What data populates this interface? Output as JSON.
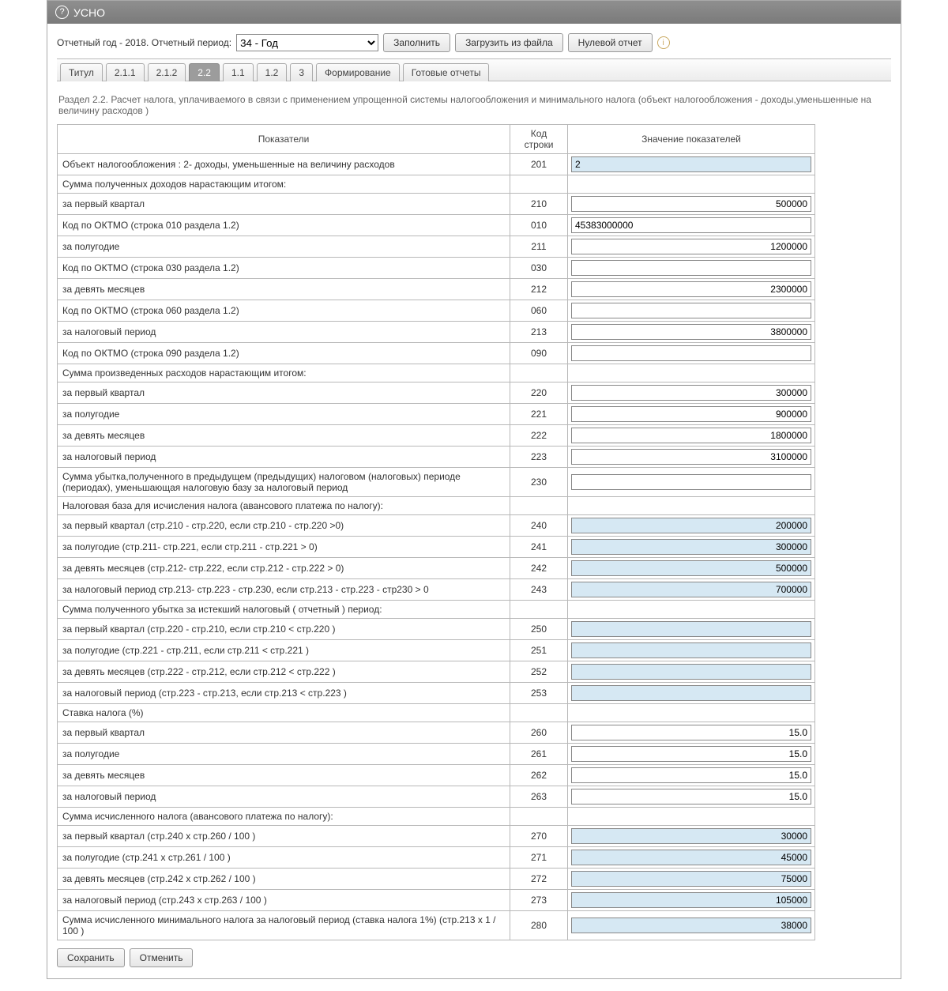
{
  "titlebar": {
    "title": "УСНО",
    "help_icon": "?"
  },
  "filters": {
    "year_label": "Отчетный год - 2018.  Отчетный период:",
    "period_selected": "34 - Год",
    "fill_btn": "Заполнить",
    "load_btn": "Загрузить из файла",
    "zero_btn": "Нулевой отчет",
    "info_icon": "i"
  },
  "tabs": [
    {
      "label": "Титул",
      "active": false
    },
    {
      "label": "2.1.1",
      "active": false
    },
    {
      "label": "2.1.2",
      "active": false
    },
    {
      "label": "2.2",
      "active": true
    },
    {
      "label": "1.1",
      "active": false
    },
    {
      "label": "1.2",
      "active": false
    },
    {
      "label": "3",
      "active": false
    },
    {
      "label": "Формирование",
      "active": false
    },
    {
      "label": "Готовые отчеты",
      "active": false
    }
  ],
  "section_title": "Раздел 2.2. Расчет налога, уплачиваемого в связи с применением упрощенной системы налогообложения и минимального налога (объект налогообложения - доходы,уменьшенные на величину расходов )",
  "columns": {
    "c1": "Показатели",
    "c2": "Код строки",
    "c3": "Значение показателей"
  },
  "rows": [
    {
      "label": "Объект налогообложения : 2- доходы, уменьшенные на величину расходов",
      "code": "201",
      "value": "2",
      "readonly": true,
      "align": "left"
    },
    {
      "label": "Сумма полученных доходов нарастающим итогом:",
      "header": true
    },
    {
      "label": "за первый квартал",
      "code": "210",
      "value": "500000"
    },
    {
      "label": "Код по ОКТМО (строка 010 раздела 1.2)",
      "code": "010",
      "value": "45383000000",
      "align": "left"
    },
    {
      "label": "за полугодие",
      "code": "211",
      "value": "1200000"
    },
    {
      "label": "Код по ОКТМО (строка 030 раздела 1.2)",
      "code": "030",
      "value": "",
      "align": "left"
    },
    {
      "label": "за девять месяцев",
      "code": "212",
      "value": "2300000"
    },
    {
      "label": "Код по ОКТМО (строка 060 раздела 1.2)",
      "code": "060",
      "value": "",
      "align": "left"
    },
    {
      "label": "за налоговый период",
      "code": "213",
      "value": "3800000"
    },
    {
      "label": "Код по ОКТМО (строка 090 раздела 1.2)",
      "code": "090",
      "value": "",
      "align": "left"
    },
    {
      "label": "Сумма произведенных расходов нарастающим итогом:",
      "header": true
    },
    {
      "label": "за первый квартал",
      "code": "220",
      "value": "300000"
    },
    {
      "label": "за полугодие",
      "code": "221",
      "value": "900000"
    },
    {
      "label": "за девять месяцев",
      "code": "222",
      "value": "1800000"
    },
    {
      "label": "за налоговый период",
      "code": "223",
      "value": "3100000"
    },
    {
      "label": "Сумма убытка,полученного в предыдущем (предыдущих) налоговом (налоговых) периоде (периодах), уменьшающая налоговую базу за налоговый период",
      "code": "230",
      "value": ""
    },
    {
      "label": "Налоговая база для исчисления налога (авансового платежа по налогу):",
      "header": true
    },
    {
      "label": "за первый квартал (стр.210 - стр.220, если стр.210 - стр.220 >0)",
      "code": "240",
      "value": "200000",
      "readonly": true
    },
    {
      "label": "за полугодие (стр.211- стр.221, если стр.211 - стр.221 > 0)",
      "code": "241",
      "value": "300000",
      "readonly": true
    },
    {
      "label": "за девять месяцев (стр.212- стр.222, если стр.212 - стр.222 > 0)",
      "code": "242",
      "value": "500000",
      "readonly": true
    },
    {
      "label": "за налоговый период стр.213- стр.223 - стр.230, если стр.213 - стр.223 - стр230 > 0",
      "code": "243",
      "value": "700000",
      "readonly": true
    },
    {
      "label": "Сумма полученного убытка за истекший налоговый ( отчетный ) период:",
      "header": true
    },
    {
      "label": "за первый квартал (стр.220 - стр.210, если стр.210 < стр.220 )",
      "code": "250",
      "value": "",
      "readonly": true
    },
    {
      "label": "за полугодие (стр.221 - стр.211, если стр.211 < стр.221 )",
      "code": "251",
      "value": "",
      "readonly": true
    },
    {
      "label": "за девять месяцев (стр.222 - стр.212, если стр.212 < стр.222 )",
      "code": "252",
      "value": "",
      "readonly": true
    },
    {
      "label": "за налоговый период (стр.223 - стр.213, если стр.213 < стр.223 )",
      "code": "253",
      "value": "",
      "readonly": true
    },
    {
      "label": "Ставка налога (%)",
      "header": true
    },
    {
      "label": "за первый квартал",
      "code": "260",
      "value": "15.0"
    },
    {
      "label": "за полугодие",
      "code": "261",
      "value": "15.0"
    },
    {
      "label": "за девять месяцев",
      "code": "262",
      "value": "15.0"
    },
    {
      "label": "за налоговый период",
      "code": "263",
      "value": "15.0"
    },
    {
      "label": "Сумма исчисленного налога (авансового платежа по налогу):",
      "header": true
    },
    {
      "label": "за первый квартал (стр.240 x стр.260 / 100 )",
      "code": "270",
      "value": "30000",
      "readonly": true
    },
    {
      "label": "за полугодие (стр.241 x стр.261 / 100 )",
      "code": "271",
      "value": "45000",
      "readonly": true
    },
    {
      "label": "за девять месяцев (стр.242 x стр.262 / 100 )",
      "code": "272",
      "value": "75000",
      "readonly": true
    },
    {
      "label": "за налоговый период (стр.243 x стр.263 / 100 )",
      "code": "273",
      "value": "105000",
      "readonly": true
    },
    {
      "label": "Сумма исчисленного минимального налога за налоговый период (ставка налога 1%) (стр.213 x 1 / 100 )",
      "code": "280",
      "value": "38000",
      "readonly": true
    }
  ],
  "footer": {
    "save": "Сохранить",
    "cancel": "Отменить"
  }
}
